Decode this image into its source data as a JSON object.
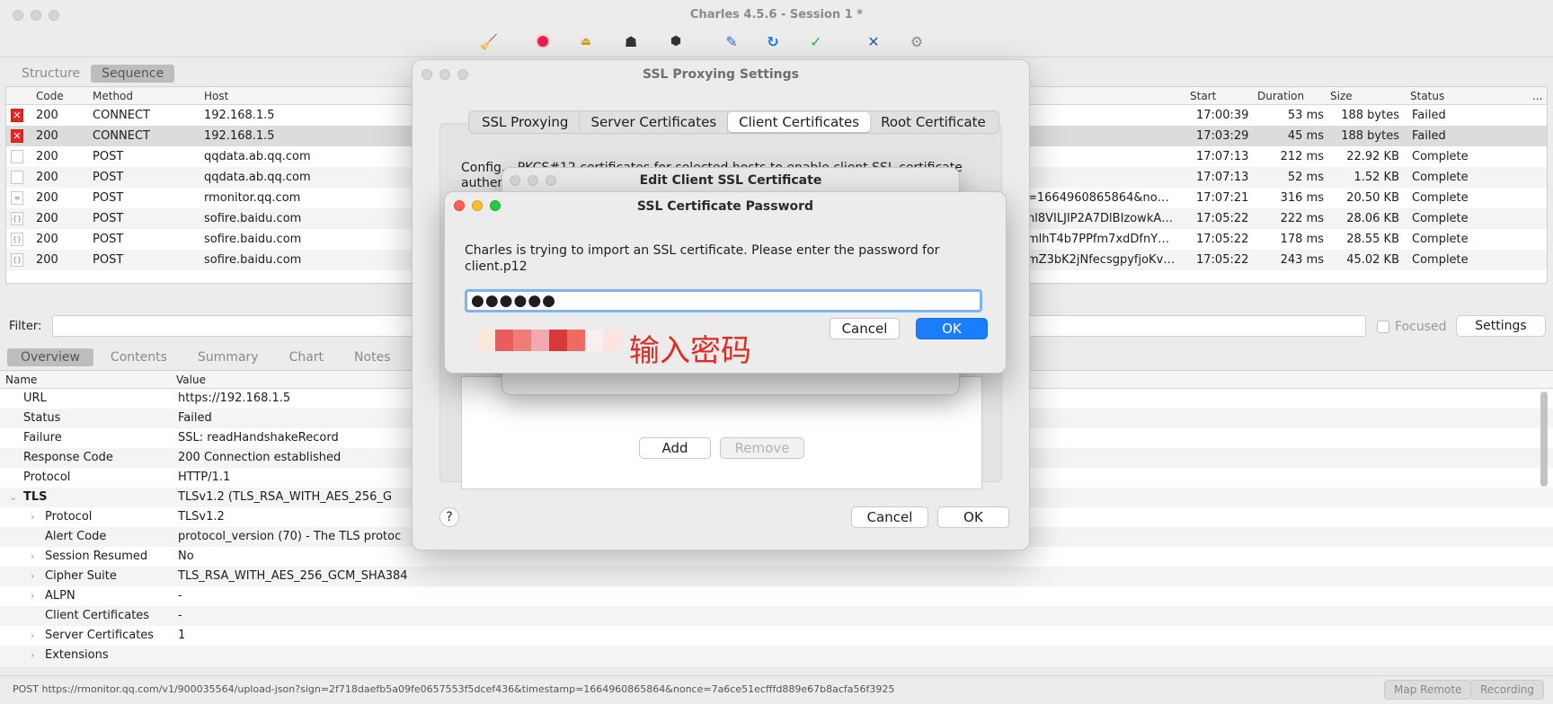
{
  "window": {
    "title": "Charles 4.5.6 - Session 1 *",
    "toolbar_icons": [
      "broom-icon",
      "record-icon",
      "throttle-icon",
      "turtle-icon",
      "hexagon-breakpoint-icon",
      "pen-icon",
      "refresh-icon",
      "check-icon",
      "tools-icon",
      "gear-icon"
    ]
  },
  "left_tabs": [
    "Structure",
    "Sequence"
  ],
  "sequence": {
    "columns": [
      "Code",
      "Method",
      "Host",
      "Start",
      "Duration",
      "Size",
      "Status",
      "..."
    ],
    "rows": [
      {
        "icon": "error-icon",
        "code": "200",
        "method": "CONNECT",
        "host": "192.168.1.5",
        "path_tail": "",
        "start": "17:00:39",
        "duration": "53 ms",
        "size": "188 bytes",
        "status": "Failed"
      },
      {
        "icon": "error-icon",
        "code": "200",
        "method": "CONNECT",
        "host": "192.168.1.5",
        "path_tail": "",
        "start": "17:03:29",
        "duration": "45 ms",
        "size": "188 bytes",
        "status": "Failed"
      },
      {
        "icon": "doc-icon",
        "code": "200",
        "method": "POST",
        "host": "qqdata.ab.qq.com",
        "path_tail": "",
        "start": "17:07:13",
        "duration": "212 ms",
        "size": "22.92 KB",
        "status": "Complete"
      },
      {
        "icon": "doc-icon",
        "code": "200",
        "method": "POST",
        "host": "qqdata.ab.qq.com",
        "path_tail": "",
        "start": "17:07:13",
        "duration": "52 ms",
        "size": "1.52 KB",
        "status": "Complete"
      },
      {
        "icon": "text-doc-icon",
        "code": "200",
        "method": "POST",
        "host": "rmonitor.qq.com",
        "path_tail": "=1664960865864&no…",
        "start": "17:07:21",
        "duration": "316 ms",
        "size": "20.50 KB",
        "status": "Complete"
      },
      {
        "icon": "json-icon",
        "code": "200",
        "method": "POST",
        "host": "sofire.baidu.com",
        "path_tail": "nl8VILJIP2A7DlBIzowkA…",
        "start": "17:05:22",
        "duration": "222 ms",
        "size": "28.06 KB",
        "status": "Complete"
      },
      {
        "icon": "json-icon",
        "code": "200",
        "method": "POST",
        "host": "sofire.baidu.com",
        "path_tail": "mlhT4b7PPfm7xdDfnY…",
        "start": "17:05:22",
        "duration": "178 ms",
        "size": "28.55 KB",
        "status": "Complete"
      },
      {
        "icon": "json-icon",
        "code": "200",
        "method": "POST",
        "host": "sofire.baidu.com",
        "path_tail": "mZ3bK2jNfecsgpyfjoKv…",
        "start": "17:05:22",
        "duration": "243 ms",
        "size": "45.02 KB",
        "status": "Complete"
      }
    ]
  },
  "filter": {
    "label": "Filter:",
    "value": "",
    "focused_label": "Focused",
    "settings_label": "Settings"
  },
  "detail_tabs": [
    "Overview",
    "Contents",
    "Summary",
    "Chart",
    "Notes"
  ],
  "detail": {
    "columns": [
      "Name",
      "Value"
    ],
    "rows": [
      {
        "name": "URL",
        "value": "https://192.168.1.5",
        "indent": 0,
        "chevron": "",
        "bold": false
      },
      {
        "name": "Status",
        "value": "Failed",
        "indent": 0,
        "chevron": "",
        "bold": false
      },
      {
        "name": "Failure",
        "value": "SSL: readHandshakeRecord",
        "indent": 0,
        "chevron": "",
        "bold": false
      },
      {
        "name": "Response Code",
        "value": "200 Connection established",
        "indent": 0,
        "chevron": "",
        "bold": false
      },
      {
        "name": "Protocol",
        "value": "HTTP/1.1",
        "indent": 0,
        "chevron": "",
        "bold": false
      },
      {
        "name": "TLS",
        "value": "TLSv1.2 (TLS_RSA_WITH_AES_256_G",
        "indent": 0,
        "chevron": "⌄",
        "bold": true
      },
      {
        "name": "Protocol",
        "value": "TLSv1.2",
        "indent": 1,
        "chevron": "›",
        "bold": false
      },
      {
        "name": "Alert Code",
        "value": "protocol_version (70) - The TLS protoc",
        "indent": 1,
        "chevron": "",
        "bold": false
      },
      {
        "name": "Session Resumed",
        "value": "No",
        "indent": 1,
        "chevron": "›",
        "bold": false
      },
      {
        "name": "Cipher Suite",
        "value": "TLS_RSA_WITH_AES_256_GCM_SHA384",
        "indent": 1,
        "chevron": "›",
        "bold": false
      },
      {
        "name": "ALPN",
        "value": "-",
        "indent": 1,
        "chevron": "›",
        "bold": false
      },
      {
        "name": "Client Certificates",
        "value": "-",
        "indent": 1,
        "chevron": "",
        "bold": false
      },
      {
        "name": "Server Certificates",
        "value": "1",
        "indent": 1,
        "chevron": "›",
        "bold": false
      },
      {
        "name": "Extensions",
        "value": "",
        "indent": 1,
        "chevron": "›",
        "bold": false
      }
    ]
  },
  "statusbar": {
    "text": "POST https://rmonitor.qq.com/v1/900035564/upload-json?sign=2f718daefb5a09fe0657553f5dcef436&timestamp=1664960865864&nonce=7a6ce51ecfffd889e67b8acfa56f3925",
    "map_remote": "Map Remote",
    "recording": "Recording"
  },
  "ssl_dialog": {
    "title": "SSL Proxying Settings",
    "tabs": [
      "SSL Proxying",
      "Server Certificates",
      "Client Certificates",
      "Root Certificate"
    ],
    "active_tab": "Client Certificates",
    "description_line1": "Config... PKCS#12 certificates for selected hosts to enable client SSL certificate",
    "description_line2": "authen...",
    "add_label": "Add",
    "remove_label": "Remove",
    "cancel_label": "Cancel",
    "ok_label": "OK",
    "help_label": "?"
  },
  "edit_dialog": {
    "title": "Edit Client SSL Certificate"
  },
  "password_dialog": {
    "title": "SSL Certificate Password",
    "message_line1": "Charles is trying to import an SSL certificate. Please enter the password for",
    "message_line2": "client.p12",
    "password_value": "●●●●●●",
    "cancel_label": "Cancel",
    "ok_label": "OK"
  },
  "annotation": {
    "text": "输入密码",
    "color": "#e02a22"
  }
}
